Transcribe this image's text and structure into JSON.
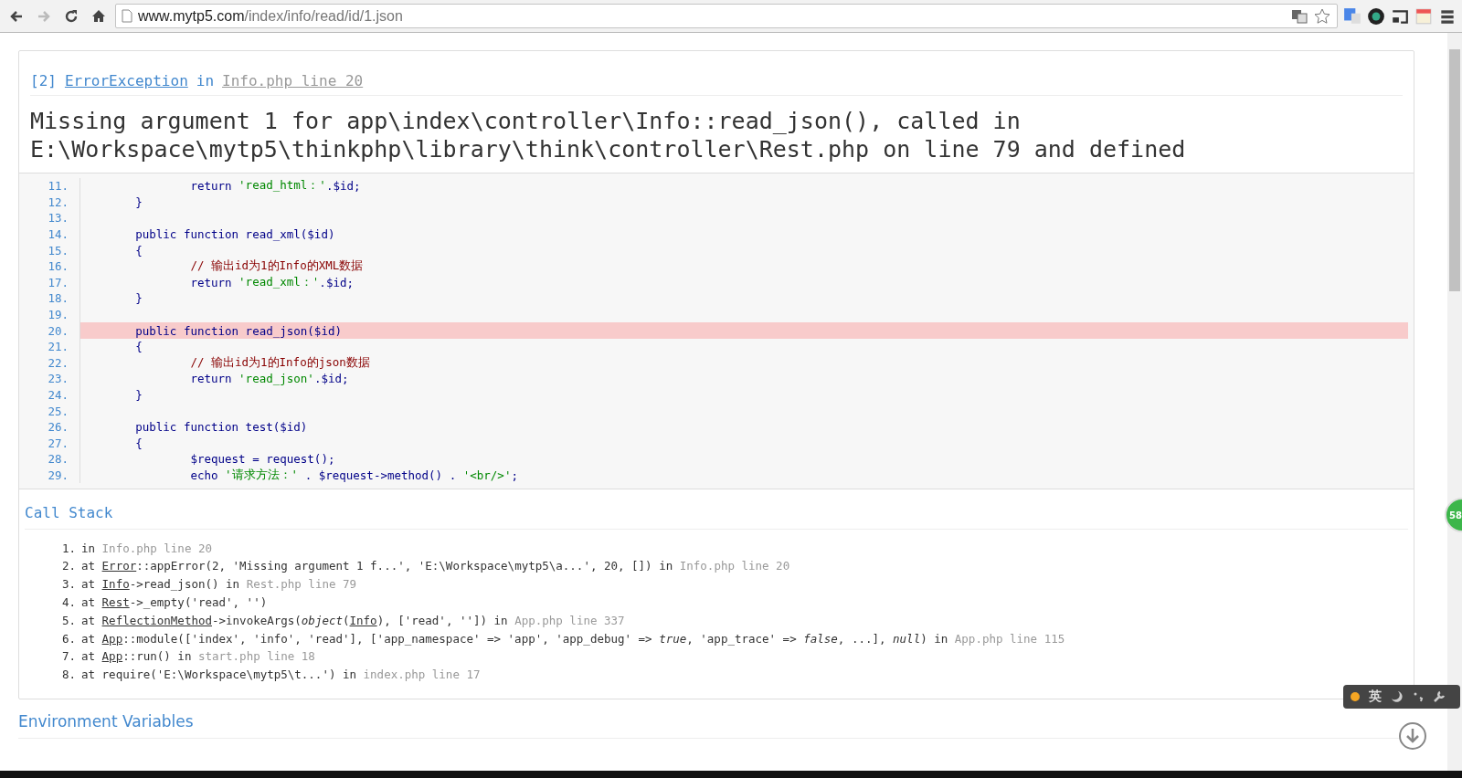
{
  "browser": {
    "url_host": "www.mytp5.com",
    "url_path": "/index/info/read/id/1.json"
  },
  "exception": {
    "code": "[2]",
    "class": "ErrorException",
    "in": "in",
    "location": "Info.php line 20",
    "message_lines": [
      "Missing argument 1 for app\\index\\controller\\Info::read_json(), called in",
      "E:\\Workspace\\mytp5\\thinkphp\\library\\think\\controller\\Rest.php on line 79 and defined"
    ]
  },
  "source": {
    "lines": [
      {
        "number": "11.",
        "highlighted": false,
        "segments": [
          {
            "kind": "code",
            "text": "                return "
          },
          {
            "kind": "string",
            "text": "'read_html：'"
          },
          {
            "kind": "code",
            "text": ".$id;"
          }
        ]
      },
      {
        "number": "12.",
        "highlighted": false,
        "segments": [
          {
            "kind": "code",
            "text": "        }"
          }
        ]
      },
      {
        "number": "13.",
        "highlighted": false
      },
      {
        "number": "14.",
        "highlighted": false,
        "segments": [
          {
            "kind": "code",
            "text": "        public function read_xml($id)"
          }
        ]
      },
      {
        "number": "15.",
        "highlighted": false,
        "segments": [
          {
            "kind": "code",
            "text": "        {"
          }
        ]
      },
      {
        "number": "16.",
        "highlighted": false,
        "segments": [
          {
            "kind": "comment",
            "text": "                // 输出id为1的Info的XML数据"
          }
        ]
      },
      {
        "number": "17.",
        "highlighted": false,
        "segments": [
          {
            "kind": "code",
            "text": "                return "
          },
          {
            "kind": "string",
            "text": "'read_xml：'"
          },
          {
            "kind": "code",
            "text": ".$id;"
          }
        ]
      },
      {
        "number": "18.",
        "highlighted": false,
        "segments": [
          {
            "kind": "code",
            "text": "        }"
          }
        ]
      },
      {
        "number": "19.",
        "highlighted": false
      },
      {
        "number": "20.",
        "highlighted": true,
        "segments": [
          {
            "kind": "code",
            "text": "        public function read_json($id)"
          }
        ]
      },
      {
        "number": "21.",
        "highlighted": false,
        "segments": [
          {
            "kind": "code",
            "text": "        {"
          }
        ]
      },
      {
        "number": "22.",
        "highlighted": false,
        "segments": [
          {
            "kind": "comment",
            "text": "                // 输出id为1的Info的json数据"
          }
        ]
      },
      {
        "number": "23.",
        "highlighted": false,
        "segments": [
          {
            "kind": "code",
            "text": "                return "
          },
          {
            "kind": "string",
            "text": "'read_json'"
          },
          {
            "kind": "code",
            "text": ".$id;"
          }
        ]
      },
      {
        "number": "24.",
        "highlighted": false,
        "segments": [
          {
            "kind": "code",
            "text": "        }"
          }
        ]
      },
      {
        "number": "25.",
        "highlighted": false
      },
      {
        "number": "26.",
        "highlighted": false,
        "segments": [
          {
            "kind": "code",
            "text": "        public function test($id)"
          }
        ]
      },
      {
        "number": "27.",
        "highlighted": false,
        "segments": [
          {
            "kind": "code",
            "text": "        {"
          }
        ]
      },
      {
        "number": "28.",
        "highlighted": false,
        "segments": [
          {
            "kind": "code",
            "text": "                $request = request();"
          }
        ]
      },
      {
        "number": "29.",
        "highlighted": false,
        "segments": [
          {
            "kind": "code",
            "text": "                echo "
          },
          {
            "kind": "string",
            "text": "'请求方法：'"
          },
          {
            "kind": "code",
            "text": " . $request->method() . "
          },
          {
            "kind": "string",
            "text": "'<br/>'"
          },
          {
            "kind": "code",
            "text": ";"
          }
        ]
      }
    ]
  },
  "call_stack": {
    "title": "Call Stack",
    "items": [
      {
        "number": "1.",
        "segments": [
          {
            "kind": "text",
            "text": "in "
          },
          {
            "kind": "file",
            "text": "Info.php line 20"
          }
        ]
      },
      {
        "number": "2.",
        "segments": [
          {
            "kind": "text",
            "text": "at "
          },
          {
            "kind": "class",
            "text": "Error"
          },
          {
            "kind": "text",
            "text": "::appError(2, 'Missing argument 1 f...', 'E:\\Workspace\\mytp5\\a...', 20, []) in "
          },
          {
            "kind": "file",
            "text": "Info.php line 20"
          }
        ]
      },
      {
        "number": "3.",
        "segments": [
          {
            "kind": "text",
            "text": "at "
          },
          {
            "kind": "class",
            "text": "Info"
          },
          {
            "kind": "text",
            "text": "->read_json() in "
          },
          {
            "kind": "file",
            "text": "Rest.php line 79"
          }
        ]
      },
      {
        "number": "4.",
        "segments": [
          {
            "kind": "text",
            "text": "at "
          },
          {
            "kind": "class",
            "text": "Rest"
          },
          {
            "kind": "text",
            "text": "->_empty('read', '')"
          }
        ]
      },
      {
        "number": "5.",
        "segments": [
          {
            "kind": "text",
            "text": "at "
          },
          {
            "kind": "class",
            "text": "ReflectionMethod"
          },
          {
            "kind": "text",
            "text": "->invokeArgs("
          },
          {
            "kind": "italic",
            "text": "object"
          },
          {
            "kind": "text",
            "text": "("
          },
          {
            "kind": "class",
            "text": "Info"
          },
          {
            "kind": "text",
            "text": "), ['read', '']) in "
          },
          {
            "kind": "file",
            "text": "App.php line 337"
          }
        ]
      },
      {
        "number": "6.",
        "segments": [
          {
            "kind": "text",
            "text": "at "
          },
          {
            "kind": "class",
            "text": "App"
          },
          {
            "kind": "text",
            "text": "::module(['index', 'info', 'read'], ['app_namespace' => 'app', 'app_debug' => "
          },
          {
            "kind": "italic",
            "text": "true"
          },
          {
            "kind": "text",
            "text": ", 'app_trace' => "
          },
          {
            "kind": "italic",
            "text": "false"
          },
          {
            "kind": "text",
            "text": ", ...], "
          },
          {
            "kind": "italic",
            "text": "null"
          },
          {
            "kind": "text",
            "text": ") in "
          },
          {
            "kind": "file",
            "text": "App.php line 115"
          }
        ]
      },
      {
        "number": "7.",
        "segments": [
          {
            "kind": "text",
            "text": "at "
          },
          {
            "kind": "class",
            "text": "App"
          },
          {
            "kind": "text",
            "text": "::run() in "
          },
          {
            "kind": "file",
            "text": "start.php line 18"
          }
        ]
      },
      {
        "number": "8.",
        "segments": [
          {
            "kind": "text",
            "text": "at require('E:\\Workspace\\mytp5\\t...') in "
          },
          {
            "kind": "file",
            "text": "index.php line 17"
          }
        ]
      }
    ]
  },
  "environment": {
    "title": "Environment Variables"
  },
  "ime_toolbar": {
    "label": "英"
  },
  "badge": {
    "text": "58"
  }
}
